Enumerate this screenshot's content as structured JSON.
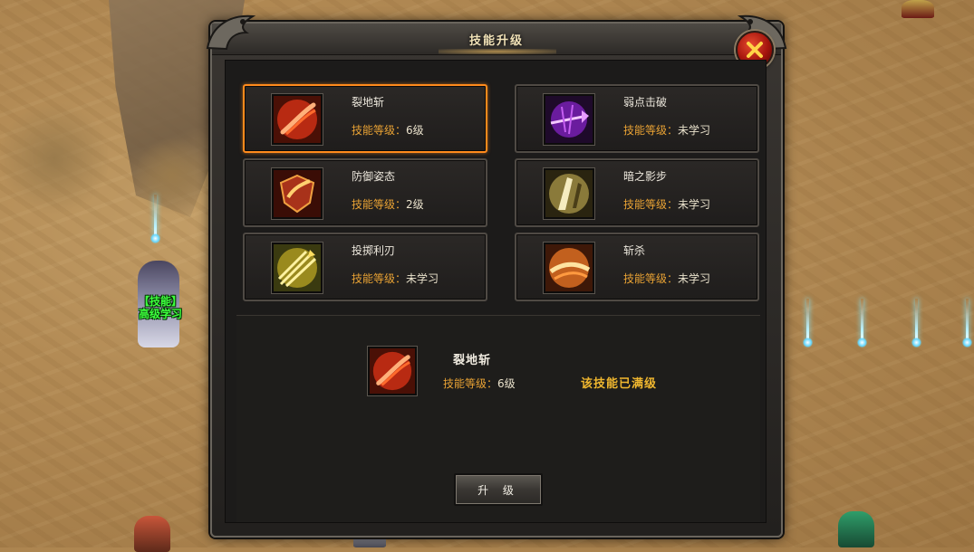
{
  "dialog": {
    "title": "技能升级"
  },
  "skills": [
    {
      "name": "裂地斩",
      "level_key": "技能等级：",
      "level_value": "6级",
      "icon": "crimson-slash-icon",
      "selected": true
    },
    {
      "name": "弱点击破",
      "level_key": "技能等级：",
      "level_value": "未学习",
      "icon": "purple-arrow-icon",
      "selected": false
    },
    {
      "name": "防御姿态",
      "level_key": "技能等级：",
      "level_value": "2级",
      "icon": "flame-shield-icon",
      "selected": false
    },
    {
      "name": "暗之影步",
      "level_key": "技能等级：",
      "level_value": "未学习",
      "icon": "shadow-step-icon",
      "selected": false
    },
    {
      "name": "投掷利刃",
      "level_key": "技能等级：",
      "level_value": "未学习",
      "icon": "throwing-blades-icon",
      "selected": false
    },
    {
      "name": "斩杀",
      "level_key": "技能等级：",
      "level_value": "未学习",
      "icon": "execute-slash-icon",
      "selected": false
    }
  ],
  "detail": {
    "name": "裂地斩",
    "level_key": "技能等级：",
    "level_value": "6级",
    "status": "该技能已满级",
    "upgrade_label": "升 级"
  },
  "npc": {
    "label_line1": "【技能】",
    "label_line2": "高级学习"
  },
  "colors": {
    "selected_border": "#ff8a1c",
    "level_key": "#e8a234",
    "max_status": "#f0b72f",
    "npc_label": "#3dff3d"
  }
}
